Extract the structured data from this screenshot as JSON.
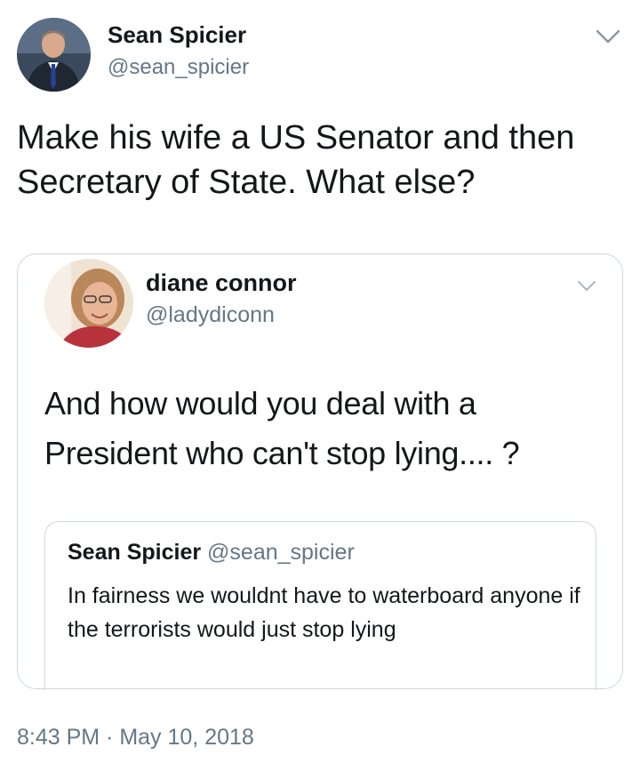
{
  "tweet": {
    "author_name": "Sean Spicier",
    "author_handle": "@sean_spicier",
    "text": "Make his wife a US Senator and then Secretary of State. What else?",
    "timestamp": "8:43 PM · May 10, 2018"
  },
  "quoted_tweet": {
    "author_name": "diane connor",
    "author_handle": "@ladydiconn",
    "text": "And how would you deal with a President who can't stop lying.... ?"
  },
  "nested_quote": {
    "author_name": "Sean Spicier",
    "author_handle": "@sean_spicier",
    "text": "In fairness we wouldnt have to waterboard anyone if the terrorists would just stop lying"
  },
  "icons": {
    "menu": "chevron-down-icon"
  },
  "colors": {
    "text_primary": "#14171a",
    "text_secondary": "#657786",
    "border": "#ccd6dd"
  }
}
